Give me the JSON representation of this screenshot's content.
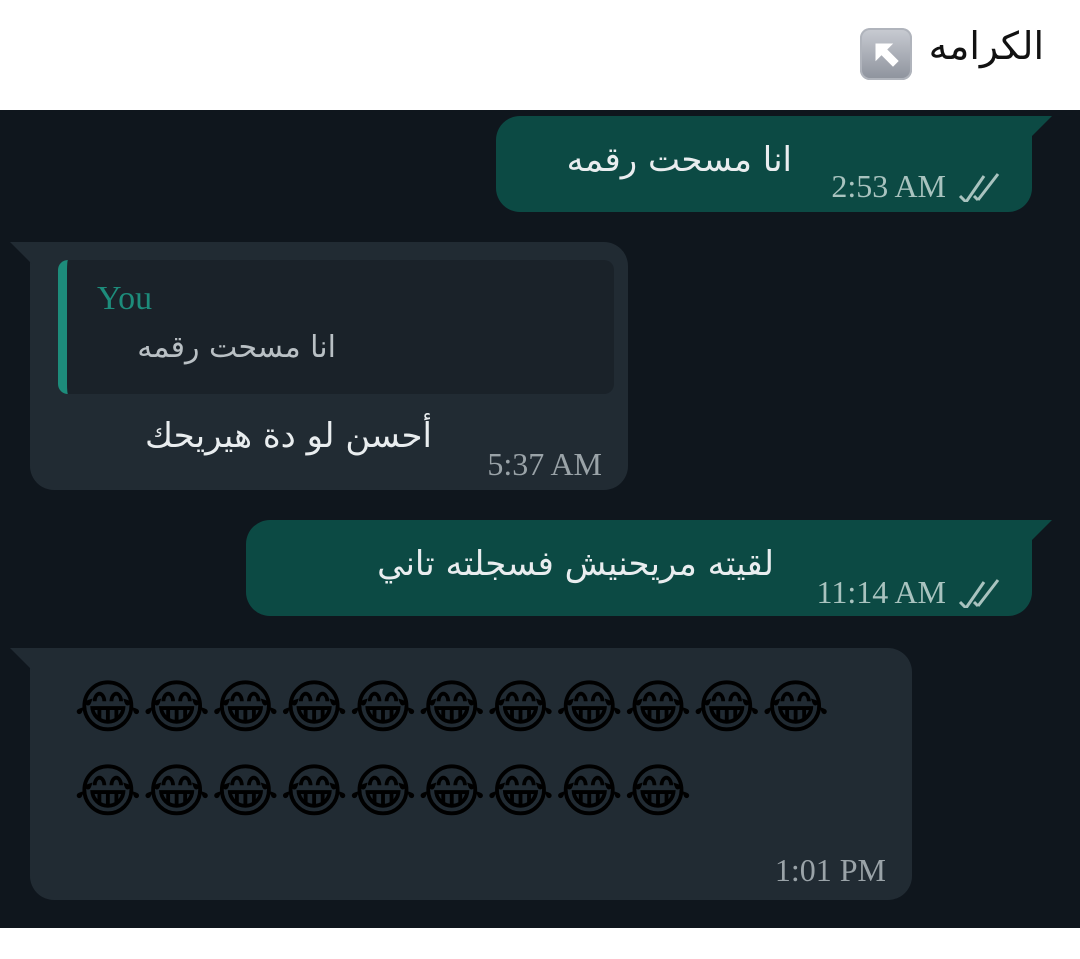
{
  "caption": {
    "text": "الكرامه",
    "icon": "up-left-arrow-icon"
  },
  "messages": [
    {
      "direction": "outgoing",
      "text": "انا مسحت رقمه",
      "time": "2:53 AM",
      "status": "read-double-check"
    },
    {
      "direction": "incoming",
      "quote_author": "You",
      "quote_text": "انا مسحت رقمه",
      "text": "أحسن لو دة هيريحك",
      "time": "5:37 AM"
    },
    {
      "direction": "outgoing",
      "text": "لقيته مريحنيش فسجلته تاني",
      "time": "11:14 AM",
      "status": "read-double-check"
    },
    {
      "direction": "incoming",
      "emoji_row_1": "😂😂😂😂😂😂😂😂😂😂😂",
      "emoji_row_2": "😂😂😂😂😂😂😂😂😂",
      "time": "1:01 PM"
    }
  ],
  "colors": {
    "chat_background": "#0f161d",
    "outgoing_bubble": "#0c4a44",
    "incoming_bubble": "#212b33",
    "quote_accent": "#1d8c7b"
  }
}
